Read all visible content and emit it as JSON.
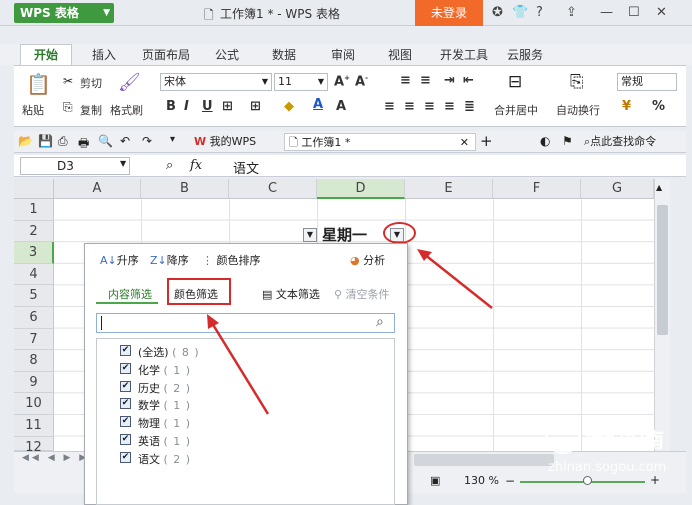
{
  "app": {
    "name": "WPS 表格",
    "doc_title": "工作簿1 * - WPS 表格",
    "login": "未登录"
  },
  "tabs": [
    "开始",
    "插入",
    "页面布局",
    "公式",
    "数据",
    "审阅",
    "视图",
    "开发工具",
    "云服务"
  ],
  "ribbon": {
    "paste": "粘贴",
    "cut": "剪切",
    "copy": "复制",
    "format_painter": "格式刷",
    "font_name": "宋体",
    "font_size": "11",
    "merge_center": "合并居中",
    "wrap_text": "自动换行",
    "number_format": "常规",
    "percent": "%"
  },
  "quickbar": {
    "my_wps": "我的WPS",
    "workbook_tab": "工作簿1 *",
    "search_cmd": "点此查找命令"
  },
  "formula_bar": {
    "cell_ref": "D3",
    "fx": "fx",
    "value": "语文"
  },
  "grid": {
    "columns": [
      "A",
      "B",
      "C",
      "D",
      "E",
      "F",
      "G"
    ],
    "rows": [
      "1",
      "2",
      "3",
      "4",
      "5",
      "6",
      "7",
      "8",
      "9",
      "10",
      "11",
      "12"
    ],
    "d2_value": "星期一"
  },
  "filter_panel": {
    "sort_asc": "升序",
    "sort_desc": "降序",
    "color_sort": "颜色排序",
    "analysis": "分析",
    "tab_content": "内容筛选",
    "tab_color": "颜色筛选",
    "text_filter": "文本筛选",
    "clear_condition": "清空条件",
    "items": [
      {
        "label": "(全选)",
        "count": "( 8 )"
      },
      {
        "label": "化学",
        "count": "( 1 )"
      },
      {
        "label": "历史",
        "count": "( 2 )"
      },
      {
        "label": "数学",
        "count": "( 1 )"
      },
      {
        "label": "物理",
        "count": "( 1 )"
      },
      {
        "label": "英语",
        "count": "( 1 )"
      },
      {
        "label": "语文",
        "count": "( 2 )"
      }
    ]
  },
  "status": {
    "zoom": "130 %"
  },
  "watermark": {
    "brand": "搜狗指南",
    "url": "zhinan.sogou.com"
  },
  "colors": {
    "accent_green": "#3f9a3f",
    "login_orange": "#f26a2a",
    "annotation_red": "#d62b2b"
  }
}
